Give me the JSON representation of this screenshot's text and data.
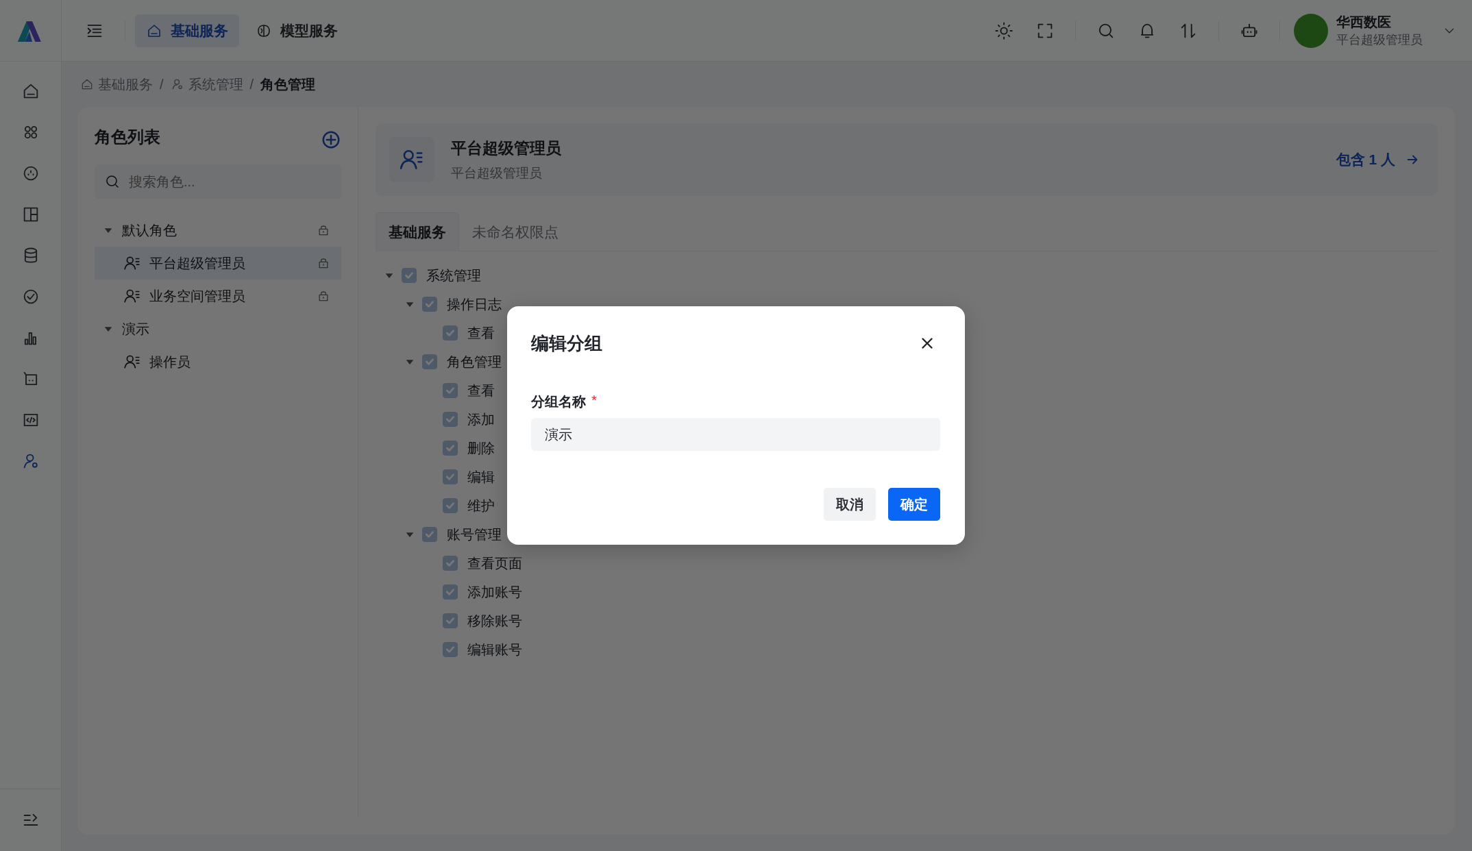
{
  "top_bar": {
    "nav_tabs": [
      {
        "label": "基础服务",
        "selected": true
      },
      {
        "label": "模型服务",
        "selected": false
      }
    ],
    "user": {
      "name": "华西数医",
      "role": "平台超级管理员"
    }
  },
  "rail": [
    {
      "selected": false
    },
    {
      "selected": false
    },
    {
      "selected": false
    },
    {
      "selected": false
    },
    {
      "selected": false
    },
    {
      "selected": false
    },
    {
      "selected": false
    },
    {
      "selected": false
    },
    {
      "selected": false
    },
    {
      "selected": true
    }
  ],
  "breadcrumb": [
    {
      "label": "基础服务",
      "selected": false
    },
    {
      "separator": "/",
      "label": "系统管理",
      "selected": false
    },
    {
      "separator": "/",
      "label": "角色管理",
      "selected": true
    }
  ],
  "role_list": {
    "title": "角色列表",
    "search": {
      "placeholder": "搜索角色..."
    },
    "groups": [
      {
        "label": "默认角色",
        "expanded": true,
        "locked": true,
        "children": [
          {
            "label": "平台超级管理员",
            "selected": true,
            "locked": true
          },
          {
            "label": "业务空间管理员",
            "selected": false,
            "locked": true
          }
        ]
      },
      {
        "label": "演示",
        "expanded": true,
        "locked": false,
        "children": [
          {
            "label": "操作员",
            "selected": false,
            "locked": false
          }
        ]
      }
    ]
  },
  "role_detail": {
    "title": "平台超级管理员",
    "subtitle": "平台超级管理员",
    "members_link": "包含 1 人"
  },
  "permission_tabs": [
    {
      "label": "基础服务",
      "selected": true
    },
    {
      "label": "未命名权限点",
      "selected": false
    }
  ],
  "permissions": [
    {
      "label": "系统管理",
      "checked": true,
      "expanded": true,
      "children": [
        {
          "label": "操作日志",
          "checked": true,
          "expanded": true,
          "children": [
            {
              "label": "查看",
              "checked": true
            }
          ]
        },
        {
          "label": "角色管理",
          "checked": true,
          "expanded": true,
          "children": [
            {
              "label": "查看",
              "checked": true
            },
            {
              "label": "添加",
              "checked": true
            },
            {
              "label": "删除",
              "checked": true
            },
            {
              "label": "编辑",
              "checked": true
            },
            {
              "label": "维护",
              "checked": true
            }
          ]
        },
        {
          "label": "账号管理",
          "checked": true,
          "expanded": true,
          "children": [
            {
              "label": "查看页面",
              "checked": true
            },
            {
              "label": "添加账号",
              "checked": true
            },
            {
              "label": "移除账号",
              "checked": true
            },
            {
              "label": "编辑账号",
              "checked": true
            }
          ]
        }
      ]
    }
  ],
  "dialog": {
    "title": "编辑分组",
    "field": {
      "label": "分组名称",
      "required_mark": "*",
      "value": "演示"
    },
    "buttons": [
      {
        "label": "取消",
        "kind": "secondary"
      },
      {
        "label": "确定",
        "kind": "primary"
      }
    ]
  }
}
